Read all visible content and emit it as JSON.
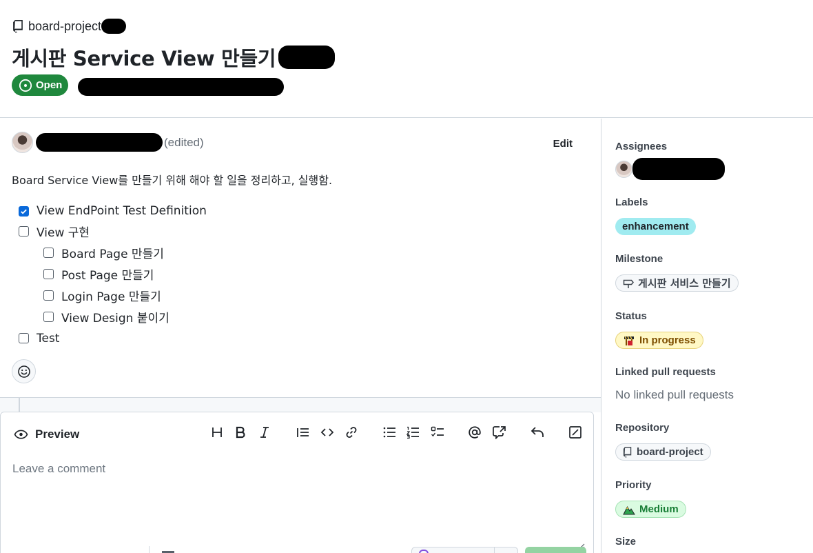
{
  "header": {
    "repo_name": "board-project",
    "title": "게시판 Service View 만들기",
    "state_label": "Open"
  },
  "issue": {
    "edited_label": "(edited)",
    "edit_label": "Edit",
    "body_text": "Board Service View를 만들기 위해 해야 할 일을 정리하고, 실행함.",
    "tasks": [
      {
        "label": "View EndPoint Test Definition",
        "checked": true,
        "level": 0
      },
      {
        "label": "View 구현",
        "checked": false,
        "level": 0
      },
      {
        "label": "Board Page 만들기",
        "checked": false,
        "level": 1
      },
      {
        "label": "Post Page 만들기",
        "checked": false,
        "level": 1
      },
      {
        "label": "Login Page 만들기",
        "checked": false,
        "level": 1
      },
      {
        "label": "View Design 붙이기",
        "checked": false,
        "level": 1
      },
      {
        "label": "Test",
        "checked": false,
        "level": 0
      }
    ]
  },
  "editor": {
    "tab_label": "Preview",
    "placeholder": "Leave a comment",
    "toolbar_icons": [
      "heading-icon",
      "bold-icon",
      "italic-icon",
      "quote-icon",
      "code-icon",
      "link-icon",
      "bulleted-list-icon",
      "numbered-list-icon",
      "task-list-icon",
      "mention-icon",
      "reference-icon",
      "reply-icon",
      "fullscreen-icon"
    ]
  },
  "sidebar": {
    "assignees_heading": "Assignees",
    "labels_heading": "Labels",
    "label_enhancement": "enhancement",
    "milestone_heading": "Milestone",
    "milestone_name": "게시판 서비스 만들기",
    "status_heading": "Status",
    "status_value": "In progress",
    "linked_pr_heading": "Linked pull requests",
    "linked_pr_value": "No linked pull requests",
    "repository_heading": "Repository",
    "repository_value": "board-project",
    "priority_heading": "Priority",
    "priority_value": "Medium",
    "size_heading": "Size"
  },
  "colors": {
    "open_green": "#1f883d",
    "label_enhancement": "#a0ebf0",
    "status_yellow": "#fff8c5",
    "priority_green": "#dafbe1",
    "checkbox_blue": "#0969da"
  }
}
